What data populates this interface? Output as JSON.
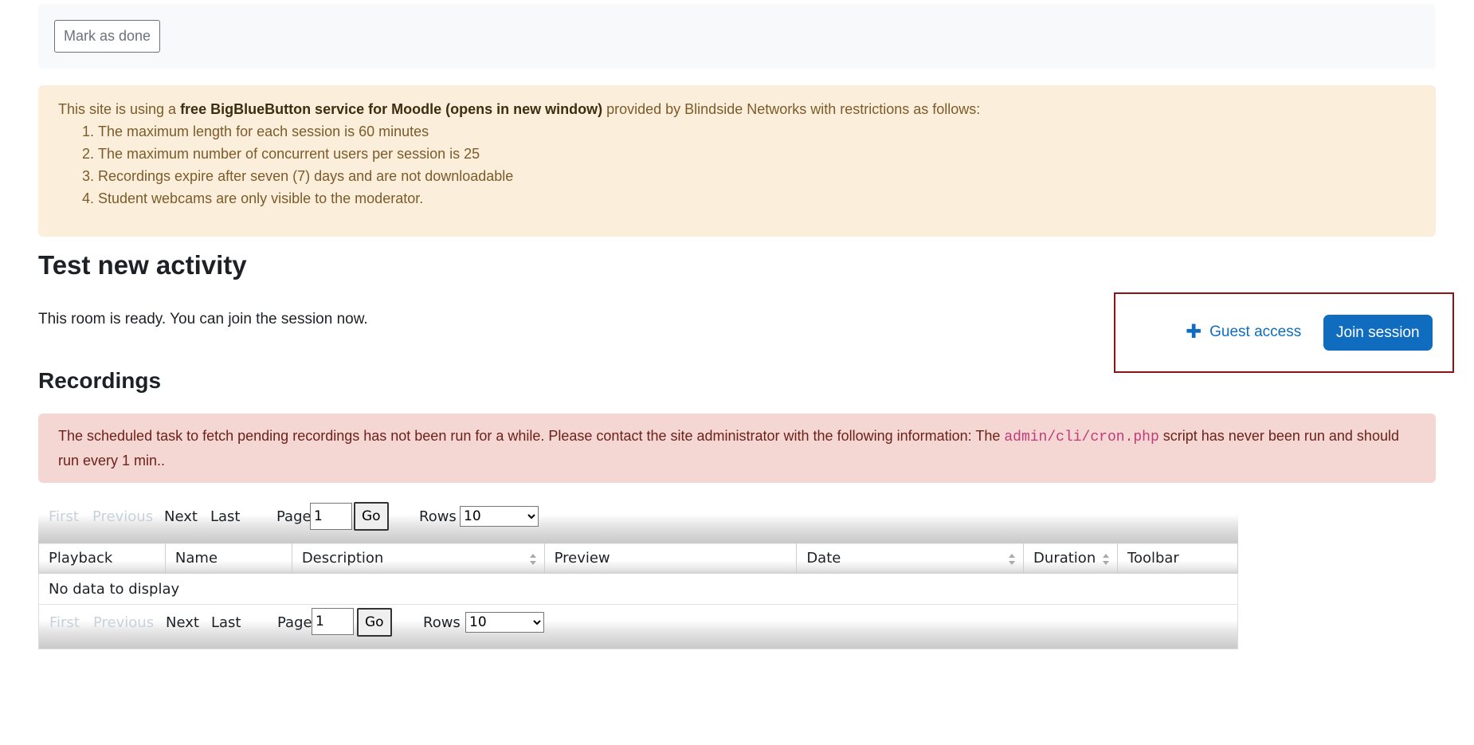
{
  "completion": {
    "mark_done_label": "Mark as done"
  },
  "bbb_notice": {
    "prefix": "This site is using a ",
    "bold": "free BigBlueButton service for Moodle (opens in new window)",
    "suffix": " provided by Blindside Networks with restrictions as follows:",
    "items": [
      "The maximum length for each session is 60 minutes",
      "The maximum number of concurrent users per session is 25",
      "Recordings expire after seven (7) days and are not downloadable",
      "Student webcams are only visible to the moderator."
    ]
  },
  "activity": {
    "title": "Test new activity",
    "status": "This room is ready. You can join the session now.",
    "guest_access_label": "Guest access",
    "join_session_label": "Join session"
  },
  "recordings": {
    "title": "Recordings",
    "cron_notice": {
      "before": "The scheduled task to fetch pending recordings has not been run for a while. Please contact the site administrator with the following information: The ",
      "code": "admin/cli/cron.php",
      "after": " script has never been run and should run every 1 min.."
    },
    "pager": {
      "first": "First",
      "previous": "Previous",
      "next": "Next",
      "last": "Last",
      "page_label": "Page",
      "page_value": "1",
      "go_label": "Go",
      "rows_label": "Rows",
      "rows_value": "10"
    },
    "columns": [
      "Playback",
      "Name",
      "Description",
      "Preview",
      "Date",
      "Duration",
      "Toolbar"
    ],
    "empty_message": "No data to display"
  },
  "colors": {
    "primary": "#0f6cbf",
    "warning_bg": "#fbefdc",
    "danger_bg": "#f4d6d2",
    "focus_border": "#8c1414"
  }
}
